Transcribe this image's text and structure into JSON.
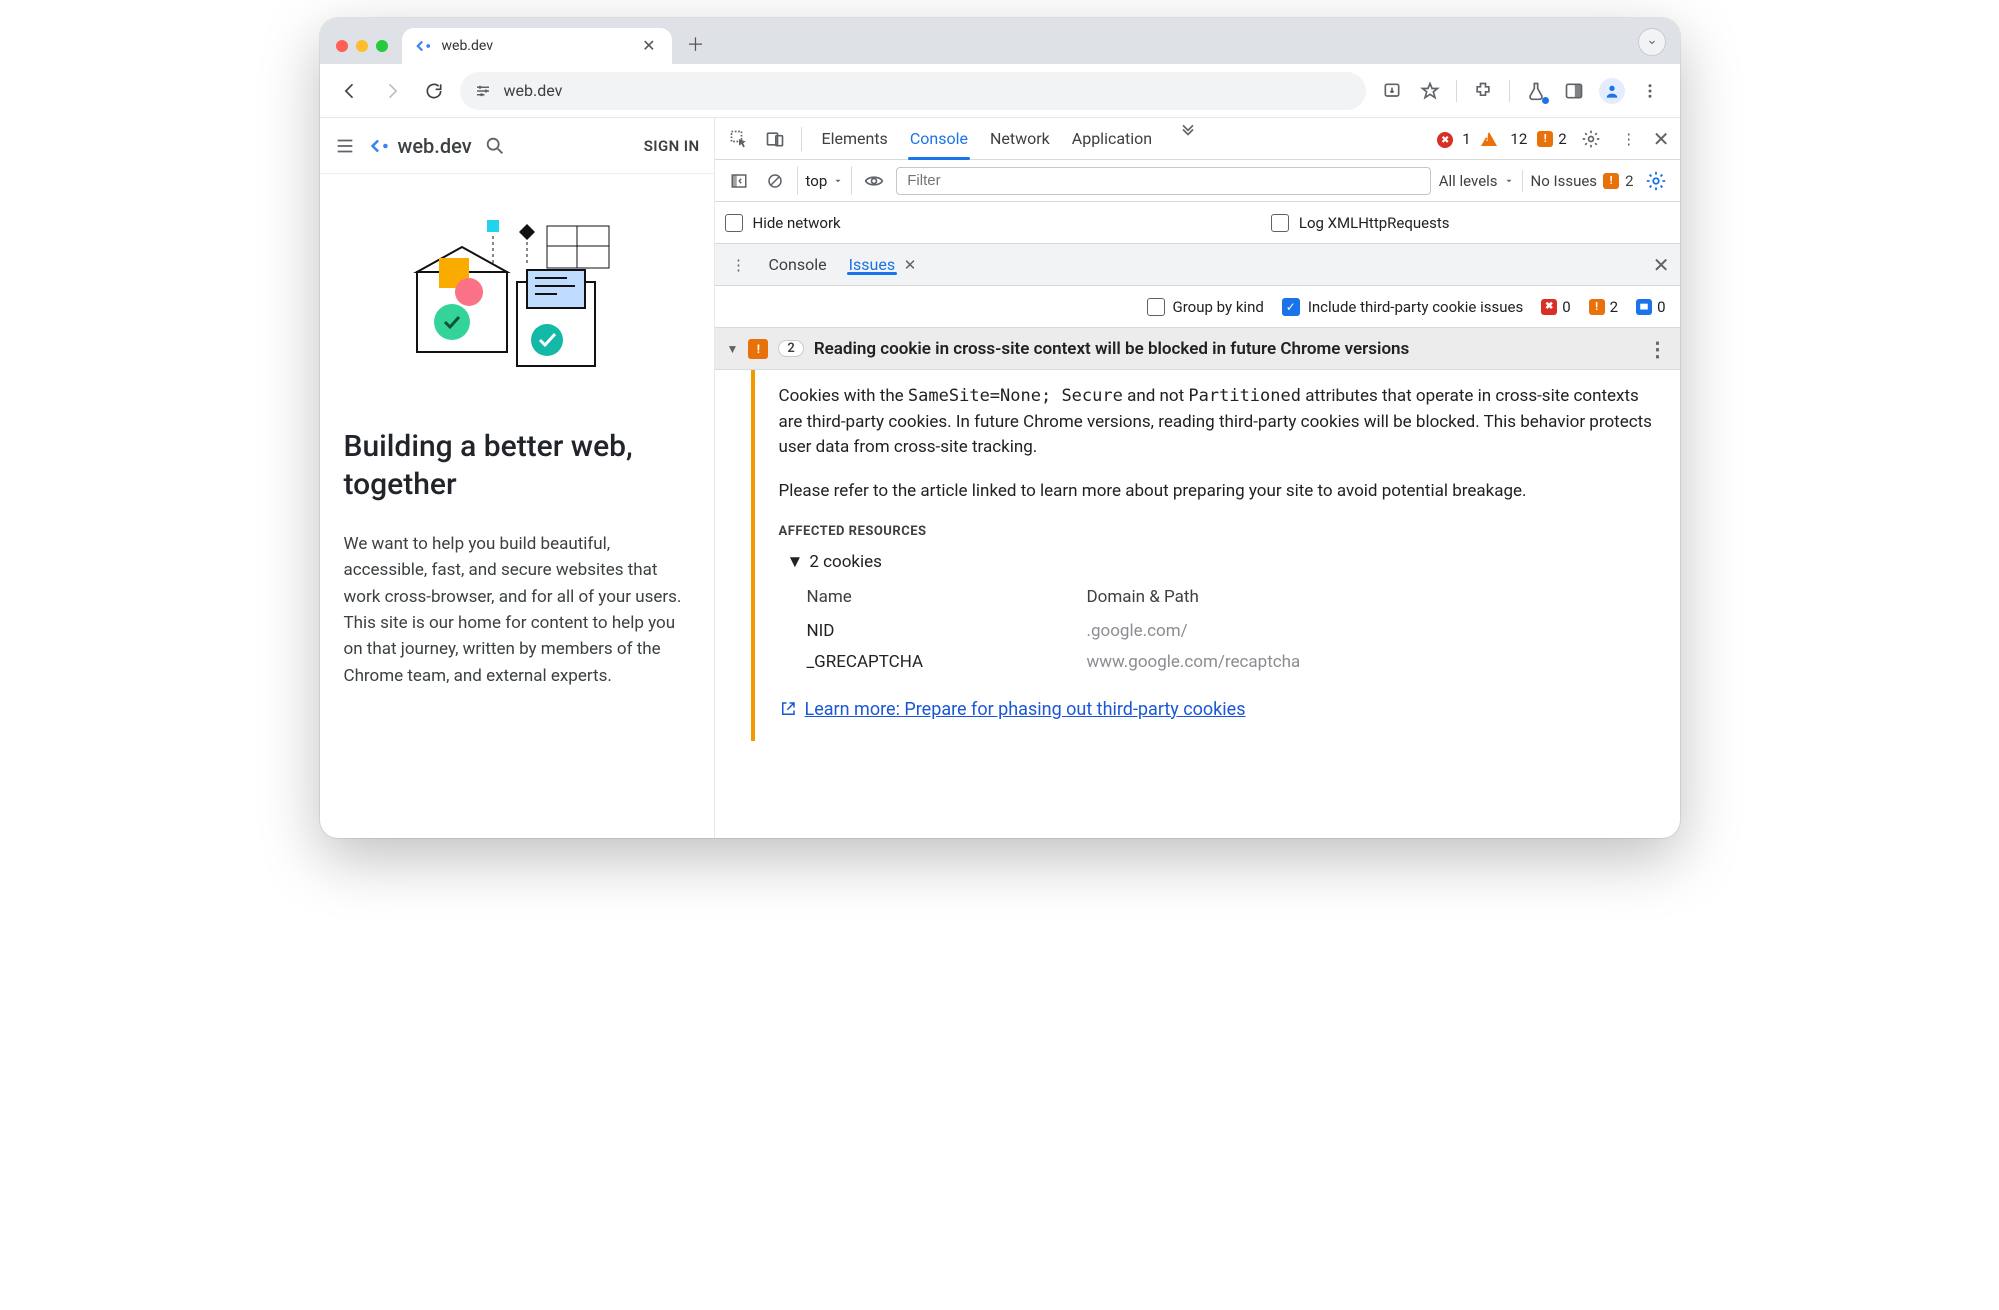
{
  "browser": {
    "tab_title": "web.dev",
    "url": "web.dev",
    "filter_placeholder": "Filter"
  },
  "page": {
    "brand": "web.dev",
    "signin": "SIGN IN",
    "heading": "Building a better web, together",
    "paragraph": "We want to help you build beautiful, accessible, fast, and secure websites that work cross-browser, and for all of your users. This site is our home for content to help you on that journey, written by members of the Chrome team, and external experts."
  },
  "devtools": {
    "tabs": {
      "elements": "Elements",
      "console": "Console",
      "network": "Network",
      "application": "Application"
    },
    "counts": {
      "errors": "1",
      "warnings": "12",
      "issues": "2"
    },
    "context": "top",
    "levels": "All levels",
    "no_issues": "No Issues",
    "no_issues_count": "2",
    "sidebar_checks": {
      "hide_network": "Hide network",
      "log_xhr": "Log XMLHttpRequests"
    },
    "drawer": {
      "console_tab": "Console",
      "issues_tab": "Issues"
    },
    "issue_filters": {
      "group": "Group by kind",
      "include": "Include third-party cookie issues",
      "c_red": "0",
      "c_orange": "2",
      "c_blue": "0"
    },
    "issue": {
      "count": "2",
      "title": "Reading cookie in cross-site context will be blocked in future Chrome versions",
      "p1a": "Cookies with the ",
      "p1b": "SameSite=None; Secure",
      "p1c": " and not ",
      "p1d": "Partitioned",
      "p1e": " attributes that operate in cross-site contexts are third-party cookies. In future Chrome versions, reading third-party cookies will be blocked. This behavior protects user data from cross-site tracking.",
      "p2": "Please refer to the article linked to learn more about preparing your site to avoid potential breakage.",
      "section": "AFFECTED RESOURCES",
      "tree": "2 cookies",
      "col1": "Name",
      "col2": "Domain & Path",
      "rows": [
        {
          "name": "NID",
          "domain": ".google.com/"
        },
        {
          "name": "_GRECAPTCHA",
          "domain": "www.google.com/recaptcha"
        }
      ],
      "learn": "Learn more: Prepare for phasing out third-party cookies"
    }
  }
}
